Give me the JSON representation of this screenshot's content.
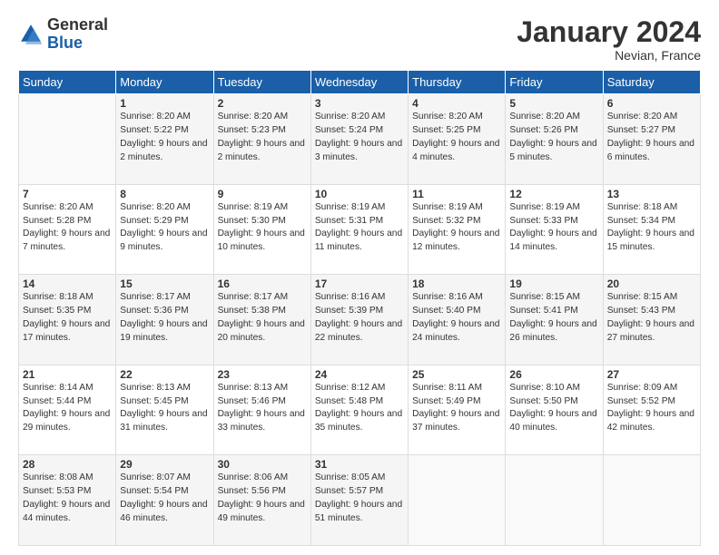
{
  "logo": {
    "general": "General",
    "blue": "Blue"
  },
  "header": {
    "month": "January 2024",
    "location": "Nevian, France"
  },
  "weekdays": [
    "Sunday",
    "Monday",
    "Tuesday",
    "Wednesday",
    "Thursday",
    "Friday",
    "Saturday"
  ],
  "weeks": [
    [
      {
        "day": "",
        "sunrise": "",
        "sunset": "",
        "daylight": ""
      },
      {
        "day": "1",
        "sunrise": "Sunrise: 8:20 AM",
        "sunset": "Sunset: 5:22 PM",
        "daylight": "Daylight: 9 hours and 2 minutes."
      },
      {
        "day": "2",
        "sunrise": "Sunrise: 8:20 AM",
        "sunset": "Sunset: 5:23 PM",
        "daylight": "Daylight: 9 hours and 2 minutes."
      },
      {
        "day": "3",
        "sunrise": "Sunrise: 8:20 AM",
        "sunset": "Sunset: 5:24 PM",
        "daylight": "Daylight: 9 hours and 3 minutes."
      },
      {
        "day": "4",
        "sunrise": "Sunrise: 8:20 AM",
        "sunset": "Sunset: 5:25 PM",
        "daylight": "Daylight: 9 hours and 4 minutes."
      },
      {
        "day": "5",
        "sunrise": "Sunrise: 8:20 AM",
        "sunset": "Sunset: 5:26 PM",
        "daylight": "Daylight: 9 hours and 5 minutes."
      },
      {
        "day": "6",
        "sunrise": "Sunrise: 8:20 AM",
        "sunset": "Sunset: 5:27 PM",
        "daylight": "Daylight: 9 hours and 6 minutes."
      }
    ],
    [
      {
        "day": "7",
        "sunrise": "Sunrise: 8:20 AM",
        "sunset": "Sunset: 5:28 PM",
        "daylight": "Daylight: 9 hours and 7 minutes."
      },
      {
        "day": "8",
        "sunrise": "Sunrise: 8:20 AM",
        "sunset": "Sunset: 5:29 PM",
        "daylight": "Daylight: 9 hours and 9 minutes."
      },
      {
        "day": "9",
        "sunrise": "Sunrise: 8:19 AM",
        "sunset": "Sunset: 5:30 PM",
        "daylight": "Daylight: 9 hours and 10 minutes."
      },
      {
        "day": "10",
        "sunrise": "Sunrise: 8:19 AM",
        "sunset": "Sunset: 5:31 PM",
        "daylight": "Daylight: 9 hours and 11 minutes."
      },
      {
        "day": "11",
        "sunrise": "Sunrise: 8:19 AM",
        "sunset": "Sunset: 5:32 PM",
        "daylight": "Daylight: 9 hours and 12 minutes."
      },
      {
        "day": "12",
        "sunrise": "Sunrise: 8:19 AM",
        "sunset": "Sunset: 5:33 PM",
        "daylight": "Daylight: 9 hours and 14 minutes."
      },
      {
        "day": "13",
        "sunrise": "Sunrise: 8:18 AM",
        "sunset": "Sunset: 5:34 PM",
        "daylight": "Daylight: 9 hours and 15 minutes."
      }
    ],
    [
      {
        "day": "14",
        "sunrise": "Sunrise: 8:18 AM",
        "sunset": "Sunset: 5:35 PM",
        "daylight": "Daylight: 9 hours and 17 minutes."
      },
      {
        "day": "15",
        "sunrise": "Sunrise: 8:17 AM",
        "sunset": "Sunset: 5:36 PM",
        "daylight": "Daylight: 9 hours and 19 minutes."
      },
      {
        "day": "16",
        "sunrise": "Sunrise: 8:17 AM",
        "sunset": "Sunset: 5:38 PM",
        "daylight": "Daylight: 9 hours and 20 minutes."
      },
      {
        "day": "17",
        "sunrise": "Sunrise: 8:16 AM",
        "sunset": "Sunset: 5:39 PM",
        "daylight": "Daylight: 9 hours and 22 minutes."
      },
      {
        "day": "18",
        "sunrise": "Sunrise: 8:16 AM",
        "sunset": "Sunset: 5:40 PM",
        "daylight": "Daylight: 9 hours and 24 minutes."
      },
      {
        "day": "19",
        "sunrise": "Sunrise: 8:15 AM",
        "sunset": "Sunset: 5:41 PM",
        "daylight": "Daylight: 9 hours and 26 minutes."
      },
      {
        "day": "20",
        "sunrise": "Sunrise: 8:15 AM",
        "sunset": "Sunset: 5:43 PM",
        "daylight": "Daylight: 9 hours and 27 minutes."
      }
    ],
    [
      {
        "day": "21",
        "sunrise": "Sunrise: 8:14 AM",
        "sunset": "Sunset: 5:44 PM",
        "daylight": "Daylight: 9 hours and 29 minutes."
      },
      {
        "day": "22",
        "sunrise": "Sunrise: 8:13 AM",
        "sunset": "Sunset: 5:45 PM",
        "daylight": "Daylight: 9 hours and 31 minutes."
      },
      {
        "day": "23",
        "sunrise": "Sunrise: 8:13 AM",
        "sunset": "Sunset: 5:46 PM",
        "daylight": "Daylight: 9 hours and 33 minutes."
      },
      {
        "day": "24",
        "sunrise": "Sunrise: 8:12 AM",
        "sunset": "Sunset: 5:48 PM",
        "daylight": "Daylight: 9 hours and 35 minutes."
      },
      {
        "day": "25",
        "sunrise": "Sunrise: 8:11 AM",
        "sunset": "Sunset: 5:49 PM",
        "daylight": "Daylight: 9 hours and 37 minutes."
      },
      {
        "day": "26",
        "sunrise": "Sunrise: 8:10 AM",
        "sunset": "Sunset: 5:50 PM",
        "daylight": "Daylight: 9 hours and 40 minutes."
      },
      {
        "day": "27",
        "sunrise": "Sunrise: 8:09 AM",
        "sunset": "Sunset: 5:52 PM",
        "daylight": "Daylight: 9 hours and 42 minutes."
      }
    ],
    [
      {
        "day": "28",
        "sunrise": "Sunrise: 8:08 AM",
        "sunset": "Sunset: 5:53 PM",
        "daylight": "Daylight: 9 hours and 44 minutes."
      },
      {
        "day": "29",
        "sunrise": "Sunrise: 8:07 AM",
        "sunset": "Sunset: 5:54 PM",
        "daylight": "Daylight: 9 hours and 46 minutes."
      },
      {
        "day": "30",
        "sunrise": "Sunrise: 8:06 AM",
        "sunset": "Sunset: 5:56 PM",
        "daylight": "Daylight: 9 hours and 49 minutes."
      },
      {
        "day": "31",
        "sunrise": "Sunrise: 8:05 AM",
        "sunset": "Sunset: 5:57 PM",
        "daylight": "Daylight: 9 hours and 51 minutes."
      },
      {
        "day": "",
        "sunrise": "",
        "sunset": "",
        "daylight": ""
      },
      {
        "day": "",
        "sunrise": "",
        "sunset": "",
        "daylight": ""
      },
      {
        "day": "",
        "sunrise": "",
        "sunset": "",
        "daylight": ""
      }
    ]
  ]
}
